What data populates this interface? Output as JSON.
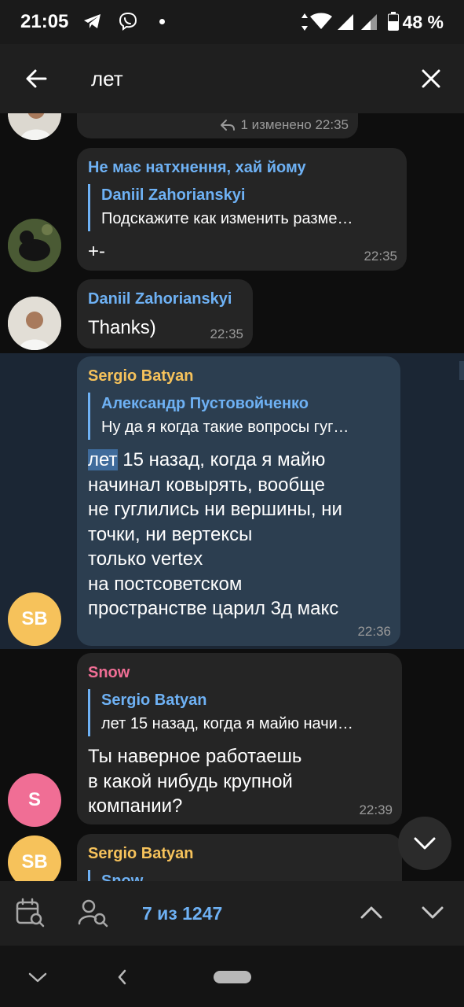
{
  "status_bar": {
    "time": "21:05",
    "battery": "48 %"
  },
  "search": {
    "query": "лет"
  },
  "messages": [
    {
      "meta": "1  изменено 22:35"
    },
    {
      "sender": "Не має натхнення, хай йому",
      "sender_color": "#6eb1f4",
      "reply_name": "Daniil Zahorianskyi",
      "reply_text": "Подскажите как изменить разме…",
      "text": "+-",
      "time": "22:35"
    },
    {
      "sender": "Daniil Zahorianskyi",
      "sender_color": "#6eb1f4",
      "text": "Thanks)",
      "time": "22:35"
    },
    {
      "sender": "Sergio Batyan",
      "sender_color": "#f6c25b",
      "avatar_initials": "SB",
      "avatar_color": "#f6c25b",
      "reply_name": "Александр Пустовойченко",
      "reply_text": "Ну да я когда такие вопросы гуг…",
      "hit": "лет",
      "lines": [
        " 15 назад, когда я майю",
        "начинал ковырять, вообще",
        "не гуглились ни вершины, ни",
        "точки, ни вертексы",
        "только vertex",
        "на постсоветском",
        "пространстве царил 3д макс"
      ],
      "time": "22:36"
    },
    {
      "sender": "Snow",
      "sender_color": "#f06e95",
      "avatar_initials": "S",
      "avatar_color": "#f06e95",
      "reply_name": "Sergio Batyan",
      "reply_text": "лет 15 назад, когда я майю начи…",
      "lines": [
        "Ты наверное работаешь",
        "в какой нибудь крупной",
        "компании?"
      ],
      "time": "22:39"
    },
    {
      "sender": "Sergio Batyan",
      "sender_color": "#f6c25b",
      "avatar_initials": "SB",
      "reply_name": "Snow"
    }
  ],
  "search_nav": {
    "counter": "7 из 1247"
  },
  "colors": {
    "accent": "#6eb1f4",
    "bubble": "#252525",
    "highlight_bubble": "#2c3e50"
  }
}
